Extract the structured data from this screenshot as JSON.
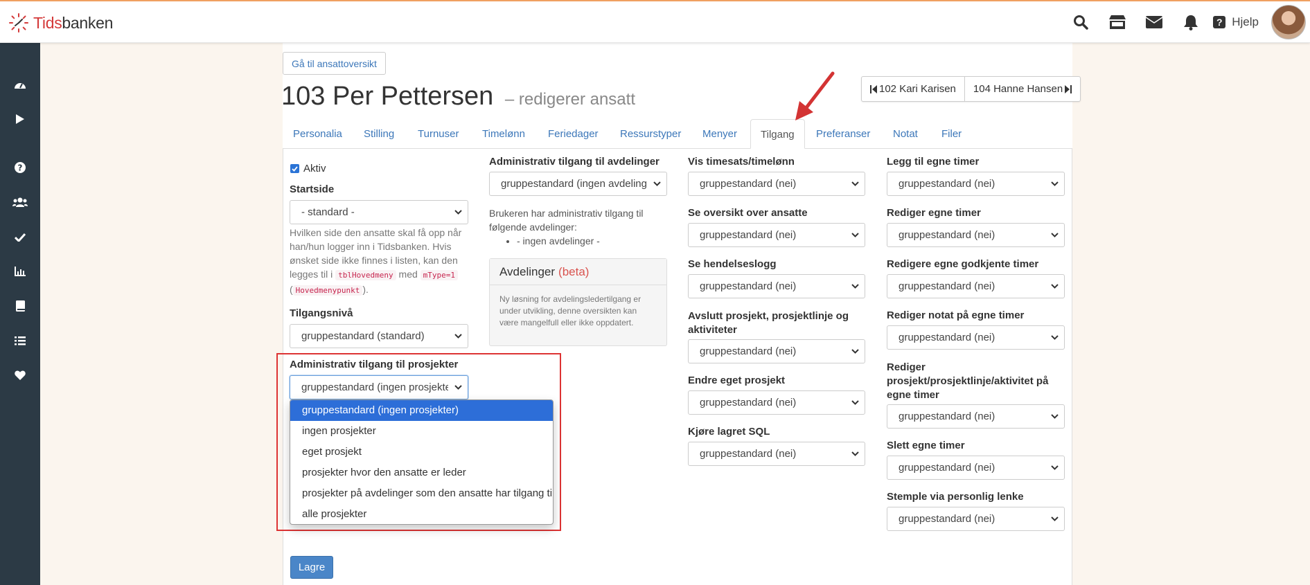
{
  "app": {
    "logo_red": "Tids",
    "logo_dark": "banken",
    "help_label": "Hjelp"
  },
  "top_icons": [
    "search-icon",
    "store-icon",
    "envelope-icon",
    "bell-icon",
    "question-icon"
  ],
  "sidebar_icons": [
    "dashboard-icon",
    "play-icon",
    "help-icon",
    "users-icon",
    "check-icon",
    "chart-icon",
    "book-icon",
    "list-icon",
    "heart-icon"
  ],
  "header": {
    "back_button": "Gå til ansattoversikt",
    "title": "103 Per Pettersen",
    "subtitle": "– redigerer ansatt",
    "prev_employee": "102 Kari Karisen",
    "next_employee": "104 Hanne Hansen"
  },
  "tabs": [
    "Personalia",
    "Stilling",
    "Turnuser",
    "Timelønn",
    "Feriedager",
    "Ressurstyper",
    "Menyer",
    "Tilgang",
    "Preferanser",
    "Notat",
    "Filer"
  ],
  "active_tab": "Tilgang",
  "col1": {
    "aktiv_label": "Aktiv",
    "aktiv_checked": true,
    "startside_label": "Startside",
    "startside_value": "- standard -",
    "help_1": "Hvilken side den ansatte skal få opp når han/hun logger inn i Tidsbanken. Hvis ønsket side ikke finnes i listen, kan den legges til i",
    "code_1": "tblHovedmeny",
    "help_2": "med",
    "code_2": "mType=1",
    "help_3": "(",
    "code_3": "Hovedmenypunkt",
    "help_4": ").",
    "tilgangsniva_label": "Tilgangsnivå",
    "tilgangsniva_value": "gruppestandard (standard)",
    "adm_prosjekter_label": "Administrativ tilgang til prosjekter",
    "adm_prosjekter_value": "gruppestandard (ingen prosjekter)",
    "dropdown_options": [
      "gruppestandard (ingen prosjekter)",
      "ingen prosjekter",
      "eget prosjekt",
      "prosjekter hvor den ansatte er leder",
      "prosjekter på avdelinger som den ansatte har tilgang til",
      "alle prosjekter"
    ],
    "save_label": "Lagre"
  },
  "col2": {
    "adm_avd_label": "Administrativ tilgang til avdelinger",
    "adm_avd_value": "gruppestandard (ingen avdelinger)",
    "desc": "Brukeren har administrativ tilgang til følgende avdelinger:",
    "list_item": "- ingen avdelinger -",
    "box_title": "Avdelinger",
    "box_beta": "(beta)",
    "box_body": "Ny løsning for avdelingsledertilgang er under utvikling, denne oversikten kan være mangelfull eller ikke oppdatert."
  },
  "col3": [
    {
      "label": "Vis timesats/timelønn",
      "value": "gruppestandard (nei)"
    },
    {
      "label": "Se oversikt over ansatte",
      "value": "gruppestandard (nei)"
    },
    {
      "label": "Se hendelseslogg",
      "value": "gruppestandard (nei)"
    },
    {
      "label": "Avslutt prosjekt, prosjektlinje og aktiviteter",
      "value": "gruppestandard (nei)"
    },
    {
      "label": "Endre eget prosjekt",
      "value": "gruppestandard (nei)"
    },
    {
      "label": "Kjøre lagret SQL",
      "value": "gruppestandard (nei)"
    }
  ],
  "col4": [
    {
      "label": "Legg til egne timer",
      "value": "gruppestandard (nei)"
    },
    {
      "label": "Rediger egne timer",
      "value": "gruppestandard (nei)"
    },
    {
      "label": "Redigere egne godkjente timer",
      "value": "gruppestandard (nei)"
    },
    {
      "label": "Rediger notat på egne timer",
      "value": "gruppestandard (nei)"
    },
    {
      "label": "Rediger prosjekt/prosjektlinje/aktivitet på egne timer",
      "value": "gruppestandard (nei)"
    },
    {
      "label": "Slett egne timer",
      "value": "gruppestandard (nei)"
    },
    {
      "label": "Stemple via personlig lenke",
      "value": "gruppestandard (nei)"
    }
  ],
  "colors": {
    "accent_blue": "#3c77b9",
    "sidebar": "#2c3a45",
    "highlight_red": "#d33333",
    "selected_option": "#2d6ed8"
  }
}
